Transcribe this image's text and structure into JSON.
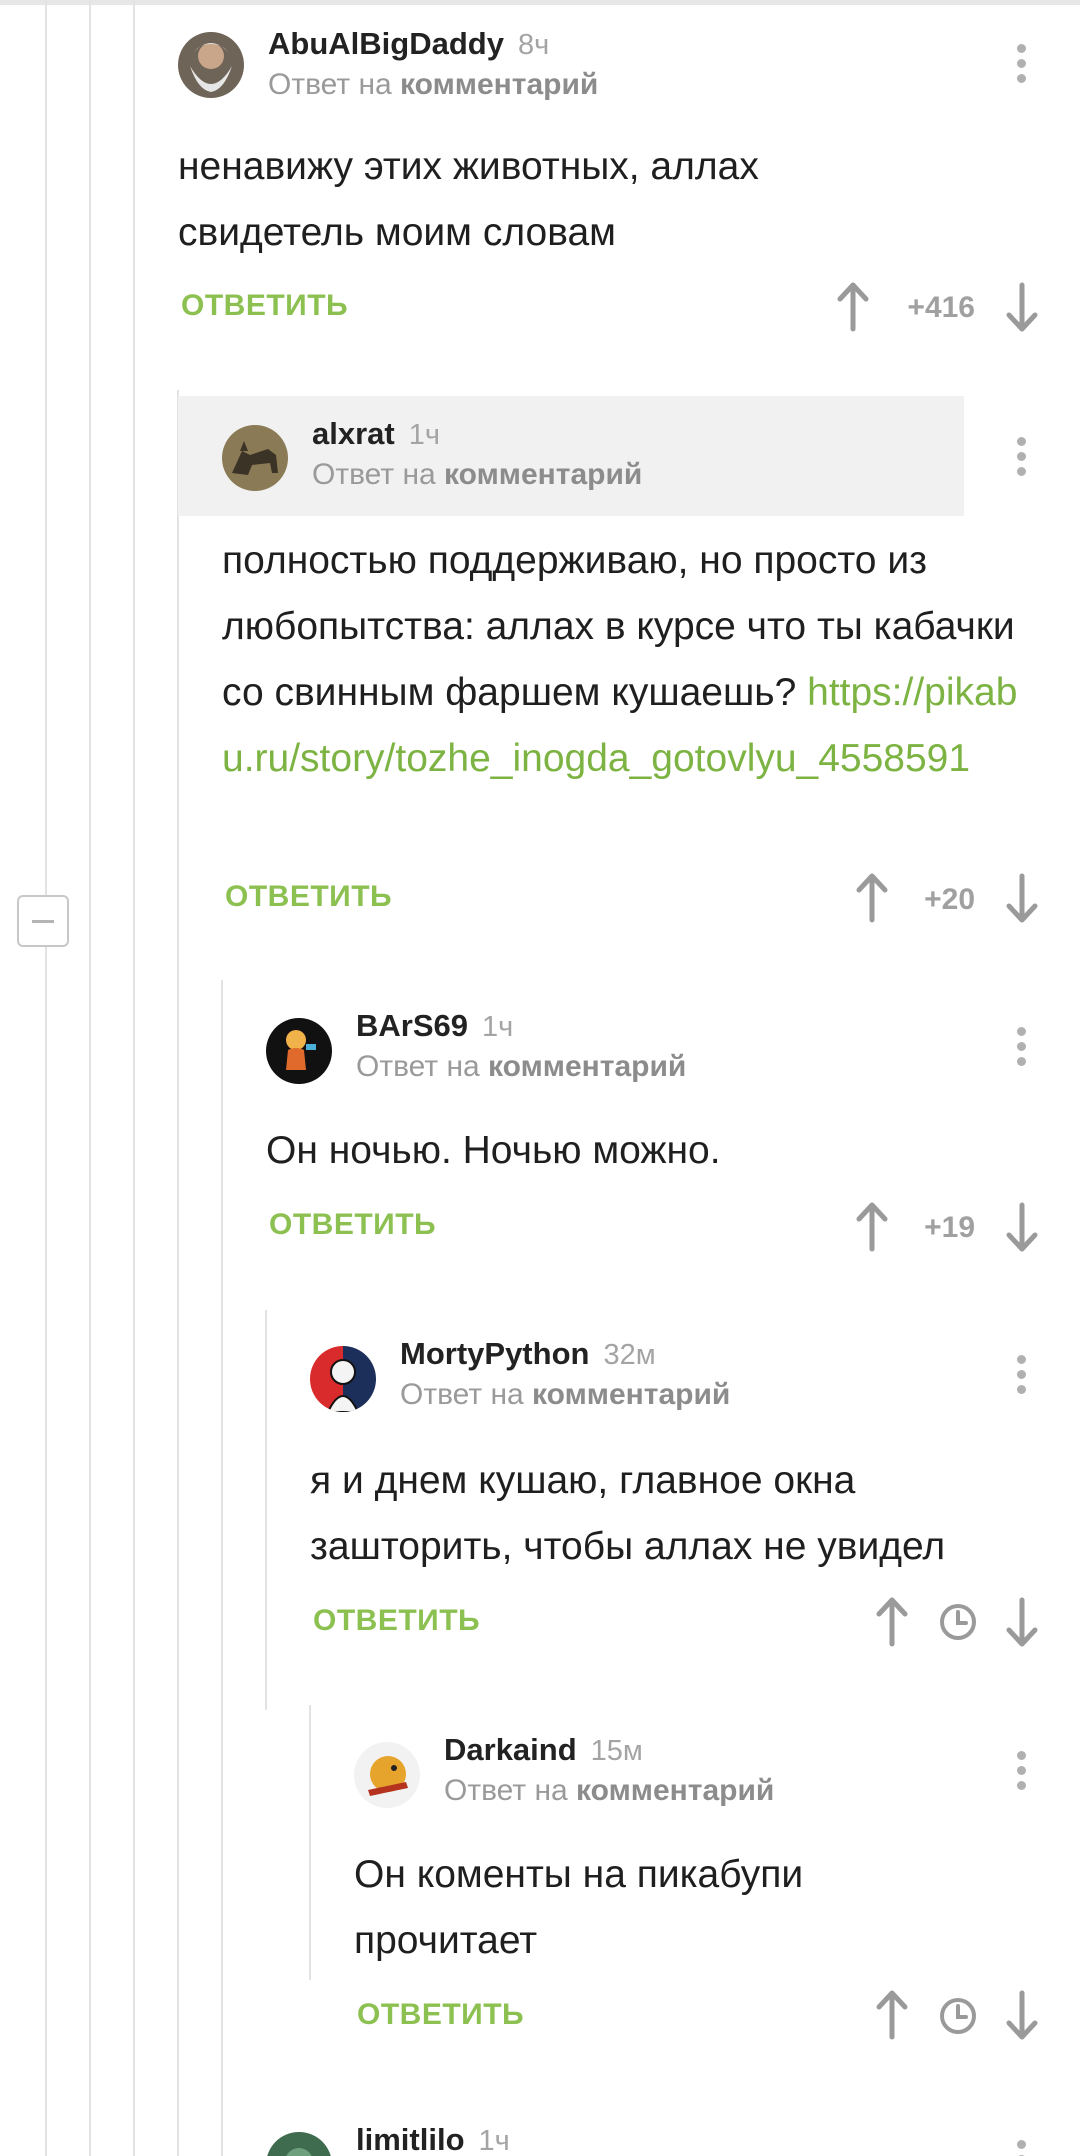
{
  "comments": [
    {
      "author": "AbuAlBigDaddy",
      "time": "8ч",
      "reply_prefix": "Ответ на",
      "reply_target": "комментарий",
      "text": "ненавижу этих животных, аллах свидетель моим словам",
      "reply_label": "ОТВЕТИТЬ",
      "rating": "+416",
      "avatar_icon": "old-man-avatar-icon"
    },
    {
      "author": "alxrat",
      "time": "1ч",
      "reply_prefix": "Ответ на",
      "reply_target": "комментарий",
      "text": "полностью поддерживаю, но просто из любопытства: аллах в курсе что ты кабачки со свинным фаршем кушаешь? ",
      "link": "https://pikabu.ru/story/tozhe_inogda_gotovlyu_4558591",
      "reply_label": "ОТВЕТИТЬ",
      "rating": "+20",
      "avatar_icon": "wolf-avatar-icon"
    },
    {
      "author": "BArS69",
      "time": "1ч",
      "reply_prefix": "Ответ на",
      "reply_target": "комментарий",
      "text": "Он ночью. Ночью можно.",
      "reply_label": "ОТВЕТИТЬ",
      "rating": "+19",
      "avatar_icon": "cartoon-character-avatar-icon"
    },
    {
      "author": "MortyPython",
      "time": "32м",
      "reply_prefix": "Ответ на",
      "reply_target": "комментарий",
      "text": "я и днем кушаю, главное окна зашторить, чтобы аллах не увидел",
      "reply_label": "ОТВЕТИТЬ",
      "rating": "",
      "avatar_icon": "bearded-man-avatar-icon"
    },
    {
      "author": "Darkaind",
      "time": "15м",
      "reply_prefix": "Ответ на",
      "reply_target": "комментарий",
      "text": "Он коменты на пикабупи прочитает",
      "reply_label": "ОТВЕТИТЬ",
      "rating": "",
      "avatar_icon": "bird-avatar-icon"
    },
    {
      "author": "limitlilo",
      "time": "1ч",
      "avatar_icon": "green-avatar-icon"
    }
  ],
  "colors": {
    "accent_green": "#8cc152",
    "link_green": "#7cb342",
    "muted_gray": "#a0a0a0",
    "highlight_bg": "#f1f1f1"
  }
}
